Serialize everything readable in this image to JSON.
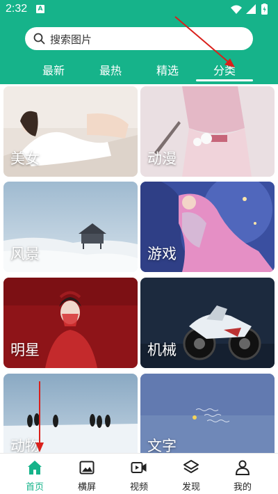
{
  "status_bar": {
    "time": "2:32",
    "notification_glyph": "A"
  },
  "search": {
    "placeholder": "搜索图片"
  },
  "tabs": [
    {
      "label": "最新",
      "active": false
    },
    {
      "label": "最热",
      "active": false
    },
    {
      "label": "精选",
      "active": false
    },
    {
      "label": "分类",
      "active": true
    }
  ],
  "categories": [
    {
      "label": "美女"
    },
    {
      "label": "动漫"
    },
    {
      "label": "风景"
    },
    {
      "label": "游戏"
    },
    {
      "label": "明星"
    },
    {
      "label": "机械"
    },
    {
      "label": "动物"
    },
    {
      "label": "文字"
    }
  ],
  "bottom_nav": [
    {
      "label": "首页",
      "icon": "home-icon",
      "active": true
    },
    {
      "label": "横屏",
      "icon": "image-icon",
      "active": false
    },
    {
      "label": "视频",
      "icon": "video-icon",
      "active": false
    },
    {
      "label": "发现",
      "icon": "layers-icon",
      "active": false
    },
    {
      "label": "我的",
      "icon": "person-icon",
      "active": false
    }
  ],
  "colors": {
    "primary": "#16b38a",
    "active_nav": "#16b38a",
    "annotation_arrow": "#d9201b"
  }
}
